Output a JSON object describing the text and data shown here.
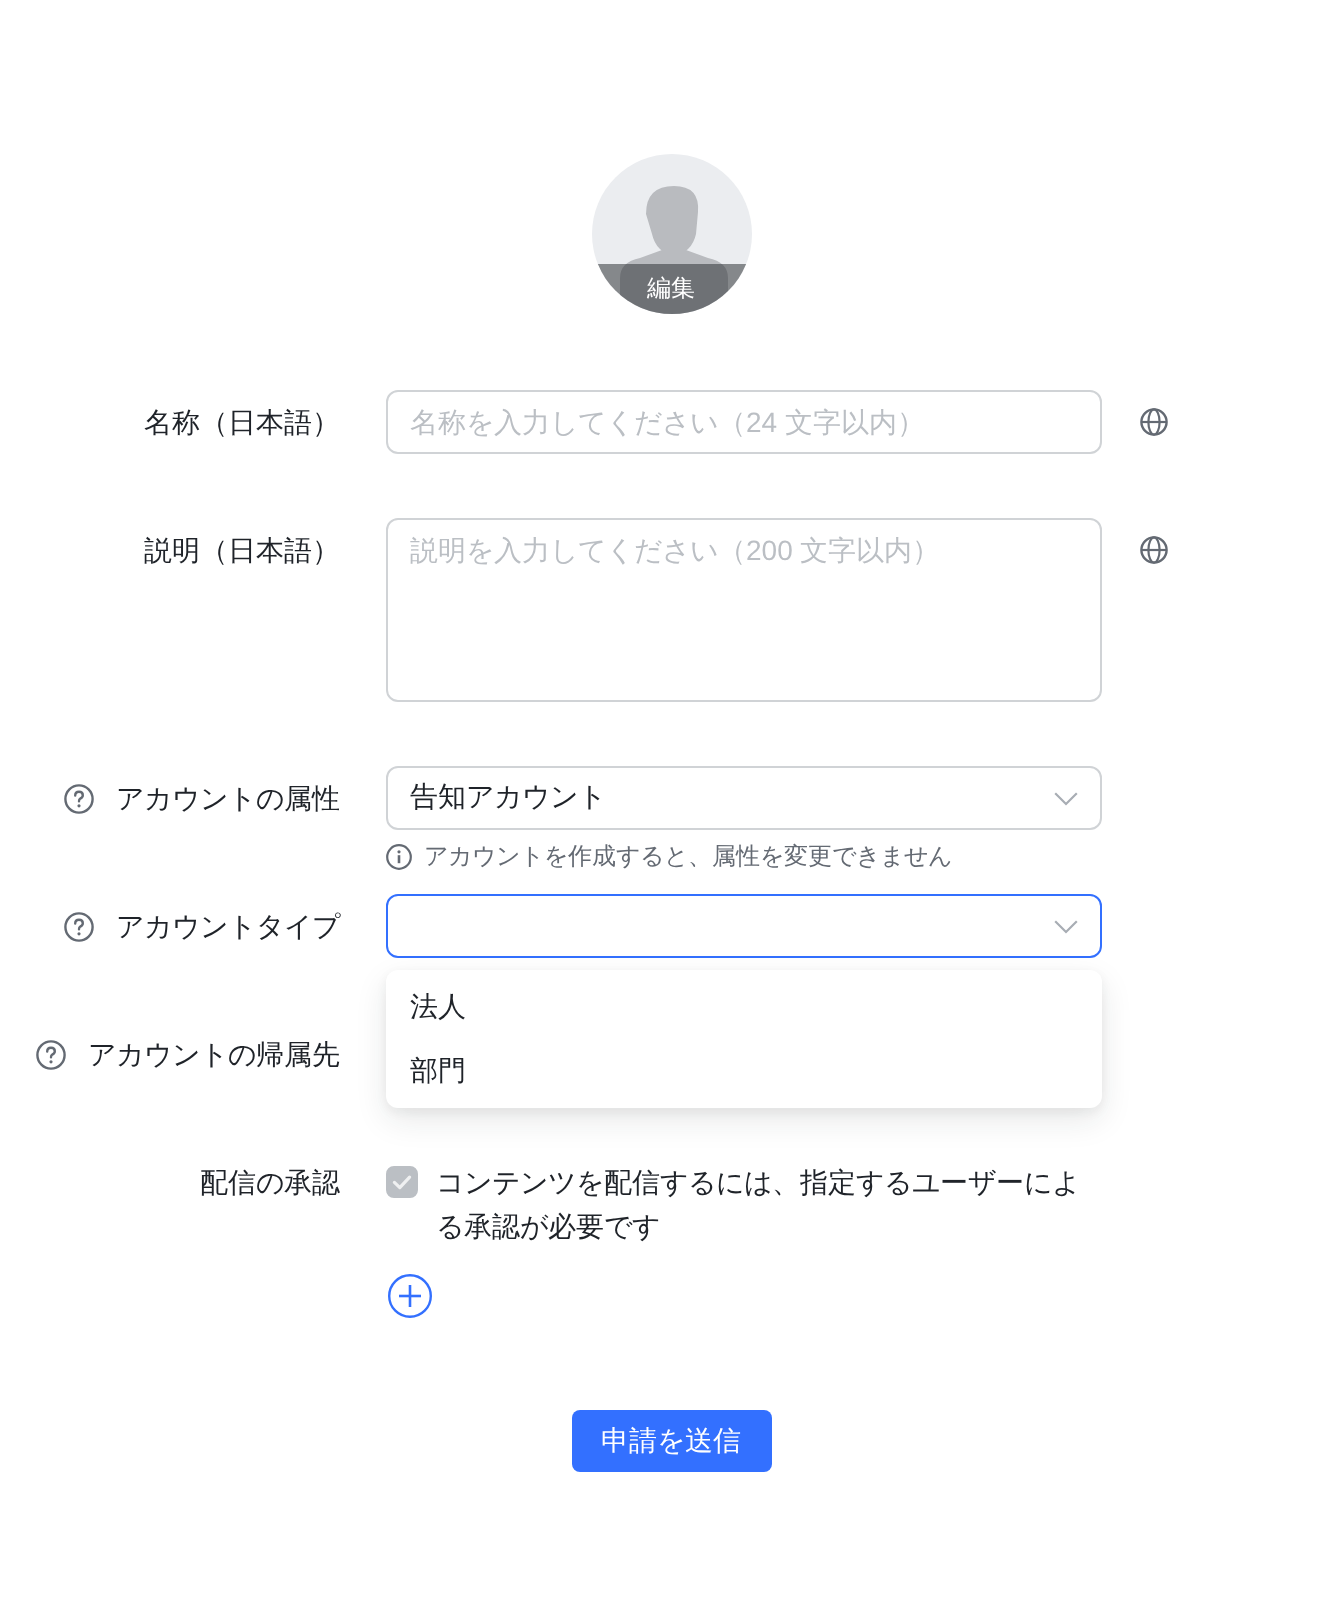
{
  "avatar": {
    "edit_label": "編集"
  },
  "fields": [
    {
      "kind": "text",
      "label": "名称（日本語）",
      "placeholder": "名称を入力してください（24 文字以内）",
      "globe": true
    },
    {
      "kind": "textarea",
      "label": "説明（日本語）",
      "placeholder": "説明を入力してください（200 文字以内）",
      "globe": true
    },
    {
      "kind": "select",
      "label": "アカウントの属性",
      "help_icon": true,
      "value": "告知アカウント",
      "expanded": false,
      "hint": "アカウントを作成すると、属性を変更できません"
    },
    {
      "kind": "select",
      "label": "アカウントタイプ",
      "help_icon": true,
      "expanded": true,
      "options": [
        {
          "label": "法人",
          "selected": false
        },
        {
          "label": "部門",
          "selected": false
        }
      ]
    },
    {
      "kind": "label_only",
      "label": "アカウントの帰属先",
      "help_icon": true
    },
    {
      "kind": "checkbox",
      "label": "配信の承認",
      "text": "コンテンツを配信するには、指定するユーザーによる承認が必要です",
      "checked": true,
      "disabled": true
    }
  ],
  "submit": "申請を送信"
}
